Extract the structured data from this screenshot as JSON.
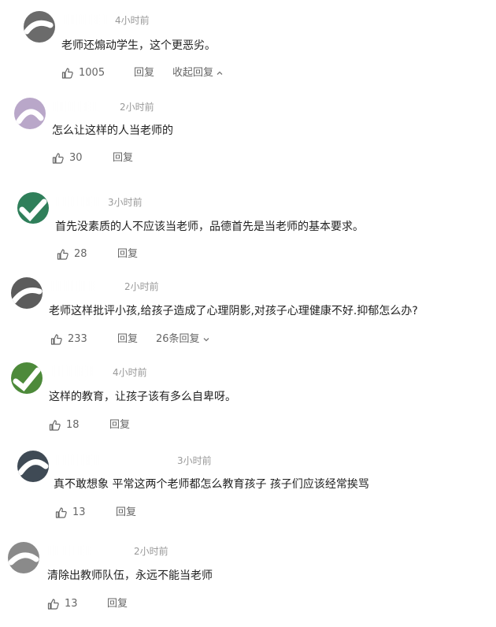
{
  "comments": [
    {
      "time": "4小时前",
      "content": "老师还煽动学生，这个更恶劣。",
      "likes": "1005",
      "reply_label": "回复",
      "more_label": "收起回复",
      "more_icon": "chevron-up-icon",
      "avatar_color": "#6b6b6b"
    },
    {
      "time": "2小时前",
      "content": "怎么让这样的人当老师的",
      "likes": "30",
      "reply_label": "回复",
      "avatar_color": "#b9a7c9"
    },
    {
      "time": "3小时前",
      "content": "首先没素质的人不应该当老师，品德首先是当老师的基本要求。",
      "likes": "28",
      "reply_label": "回复",
      "avatar_color": "#2f7f5a"
    },
    {
      "time": "2小时前",
      "content": "老师这样批评小孩,给孩子造成了心理阴影,对孩子心理健康不好.抑郁怎么办?",
      "likes": "233",
      "reply_label": "回复",
      "more_label": "26条回复",
      "more_icon": "chevron-down-icon",
      "avatar_color": "#5c5c5c"
    },
    {
      "time": "4小时前",
      "content": "这样的教育，让孩子该有多么自卑呀。",
      "likes": "18",
      "reply_label": "回复",
      "avatar_color": "#4d8a3a"
    },
    {
      "time": "3小时前",
      "content": "真不敢想象 平常这两个老师都怎么教育孩子 孩子们应该经常挨骂",
      "likes": "13",
      "reply_label": "回复",
      "avatar_color": "#3f4a55"
    },
    {
      "time": "2小时前",
      "content": "清除出教师队伍，永远不能当老师",
      "likes": "13",
      "reply_label": "回复",
      "avatar_color": "#8a8a8a"
    }
  ]
}
